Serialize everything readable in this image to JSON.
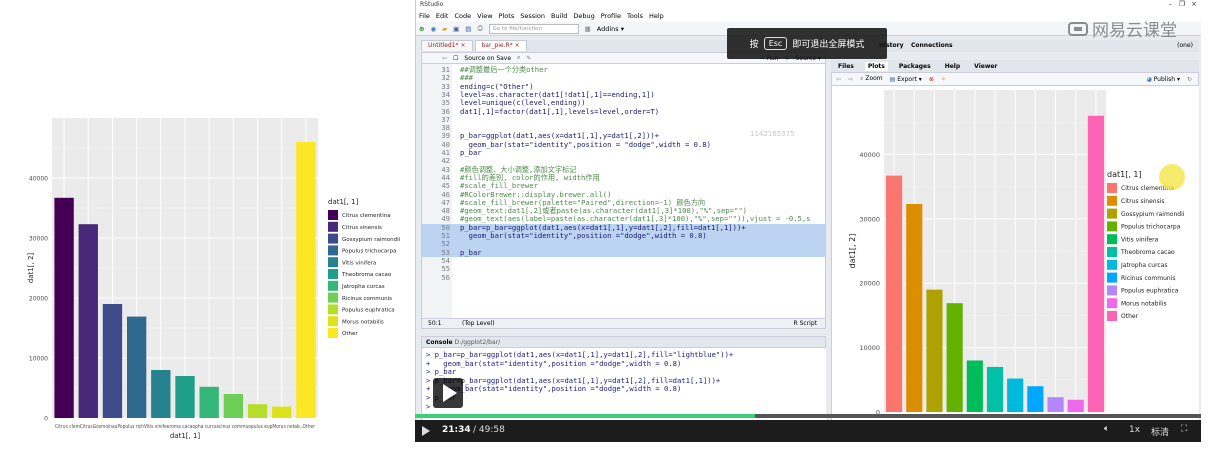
{
  "left_chart": {
    "legend_title": "dat1[, 1]",
    "ylabel": "dat1[, 2]",
    "xlabel": "dat1[, 1]",
    "y_ticks": [
      "0",
      "10000",
      "20000",
      "30000",
      "40000"
    ],
    "categories": [
      "Citrus clementina",
      "Citrus sinensis",
      "Gossypium raimondii",
      "Populus trichocarpa",
      "Vitis vinifera",
      "Theobroma cacao",
      "Jatropha curcas",
      "Ricinus communis",
      "Populus euphratica",
      "Morus notabilis",
      "Other"
    ],
    "values": [
      36700,
      32300,
      19000,
      16900,
      8000,
      7000,
      5200,
      4000,
      2300,
      1900,
      46000
    ],
    "colors": [
      "#440154",
      "#482878",
      "#3e4a89",
      "#31688e",
      "#26828e",
      "#1f9e89",
      "#35b779",
      "#6ece58",
      "#b5de2b",
      "#dde318",
      "#fde725"
    ],
    "ylim": [
      0,
      50000
    ],
    "x_tick_labels_overlap": "Citrus clemCitrusGosmoinauPopulus richVitis vinifeeroma cacaopha curcascinus commuopulus eupMorus notab..Other"
  },
  "right_chart": {
    "legend_title": "dat1[, 1]",
    "ylabel": "dat1[, 2]",
    "y_ticks": [
      "0",
      "10000",
      "20000",
      "30000",
      "40000"
    ],
    "categories": [
      "Citrus clementina",
      "Citrus sinensis",
      "Gossypium raimondii",
      "Populus trichocarpa",
      "Vitis vinifera",
      "Theobroma cacao",
      "Jatropha curcas",
      "Ricinus communis",
      "Populus euphratica",
      "Morus notabilis",
      "Other"
    ],
    "values": [
      36700,
      32300,
      19000,
      16900,
      8000,
      7000,
      5200,
      4000,
      2300,
      1900,
      46000
    ],
    "colors": [
      "#f8766d",
      "#db8e00",
      "#aea200",
      "#64b200",
      "#00bd5c",
      "#00c1a7",
      "#00bade",
      "#00a6ff",
      "#b385ff",
      "#ef67eb",
      "#ff63b6"
    ],
    "ylim": [
      0,
      50000
    ]
  },
  "rstudio": {
    "title": "RStudio",
    "menu": [
      "File",
      "Edit",
      "Code",
      "View",
      "Plots",
      "Session",
      "Build",
      "Debug",
      "Profile",
      "Tools",
      "Help"
    ],
    "goto_placeholder": "Go to file/function",
    "addins_label": "Addins",
    "editor_tabs": [
      "Untitled1*",
      "bar_pie.R*"
    ],
    "source_on_save": "Source on Save",
    "run_label": "Run",
    "source_label": "Source",
    "status_left": "50:1",
    "status_scope": "(Top Level)",
    "status_right": "R Script",
    "watermark_id": "1142165375",
    "code": [
      {
        "n": "31",
        "t": "##调整最后一个分类other",
        "c": true
      },
      {
        "n": "32",
        "t": "###",
        "c": true
      },
      {
        "n": "33",
        "t": "ending=c(\"Other\")",
        "c": false
      },
      {
        "n": "34",
        "t": "level=as.character(dat1[!dat1[,1]==ending,1])",
        "c": false
      },
      {
        "n": "35",
        "t": "level=unique(c(level,ending))",
        "c": false
      },
      {
        "n": "36",
        "t": "dat1[,1]=factor(dat1[,1],levels=level,order=T)",
        "c": false
      },
      {
        "n": "37",
        "t": "",
        "c": false
      },
      {
        "n": "38",
        "t": "",
        "c": false
      },
      {
        "n": "39",
        "t": "p_bar=ggplot(dat1,aes(x=dat1[,1],y=dat1[,2]))+",
        "c": false
      },
      {
        "n": "40",
        "t": "  geom_bar(stat=\"identity\",position = \"dodge\",width = 0.8)",
        "c": false
      },
      {
        "n": "41",
        "t": "p_bar",
        "c": false
      },
      {
        "n": "42",
        "t": "",
        "c": false
      },
      {
        "n": "43",
        "t": "#颜色调整、大小调整,添加文字标记",
        "c": true
      },
      {
        "n": "44",
        "t": "#fill的差别, color的作用, width作用",
        "c": true
      },
      {
        "n": "45",
        "t": "#scale_fill_brewer",
        "c": true
      },
      {
        "n": "46",
        "t": "#RColorBrewer::display.brewer.all()",
        "c": true
      },
      {
        "n": "47",
        "t": "#scale_fill_brewer(palette=\"Paired\",direction=-1) 颜色方向",
        "c": true
      },
      {
        "n": "48",
        "t": "#geom_text:dat1[,2]或者paste(as.character(dat1[,3]*100),\"%\",sep=\"\")",
        "c": true
      },
      {
        "n": "49",
        "t": "#geom_text(aes(label=paste(as.character(dat1[,3]*100),\"%\",sep=\"\")),vjust = -0.5,s",
        "c": true
      },
      {
        "n": "50",
        "t": "p_bar=p_bar=ggplot(dat1,aes(x=dat1[,1],y=dat1[,2],fill=dat1[,1]))+",
        "c": false
      },
      {
        "n": "51",
        "t": "  geom_bar(stat=\"identity\",position =\"dodge\",width = 0.8)",
        "c": false
      },
      {
        "n": "52",
        "t": "",
        "c": false
      },
      {
        "n": "53",
        "t": "p_bar",
        "c": false
      },
      {
        "n": "54",
        "t": "",
        "c": false
      },
      {
        "n": "55",
        "t": "",
        "c": false
      },
      {
        "n": "56",
        "t": "",
        "c": false
      }
    ],
    "console_title": "Console",
    "console_path": "D:/ggplot2/bar/",
    "console_lines": [
      "> p_bar=p_bar=ggplot(dat1,aes(x=dat1[,1],y=dat1[,2],fill=\"lightblue\"))+",
      "+   geom_bar(stat=\"identity\",position =\"dodge\",width = 0.8)",
      "> p_bar",
      "> p_bar=p_bar=ggplot(dat1,aes(x=dat1[,1],y=dat1[,2],fill=dat1[,1]))+",
      "+   geom_bar(stat=\"identity\",position =\"dodge\",width = 0.8)",
      "> p_bar",
      ">"
    ],
    "right_top_tabs": [
      "History",
      "Connections"
    ],
    "right_tabs": [
      "Files",
      "Plots",
      "Packages",
      "Help",
      "Viewer"
    ],
    "zoom_label": "Zoom",
    "export_label": "Export",
    "publish_label": "Publish",
    "env_hint": "(one)"
  },
  "esc_overlay": {
    "pre": "按",
    "key": "Esc",
    "post": "即可退出全屏模式"
  },
  "watermark": "网易云课堂",
  "video": {
    "current": "21:34",
    "total": "/ 49:58",
    "speed": "1x",
    "quality": "标清",
    "progress": 0.432
  }
}
